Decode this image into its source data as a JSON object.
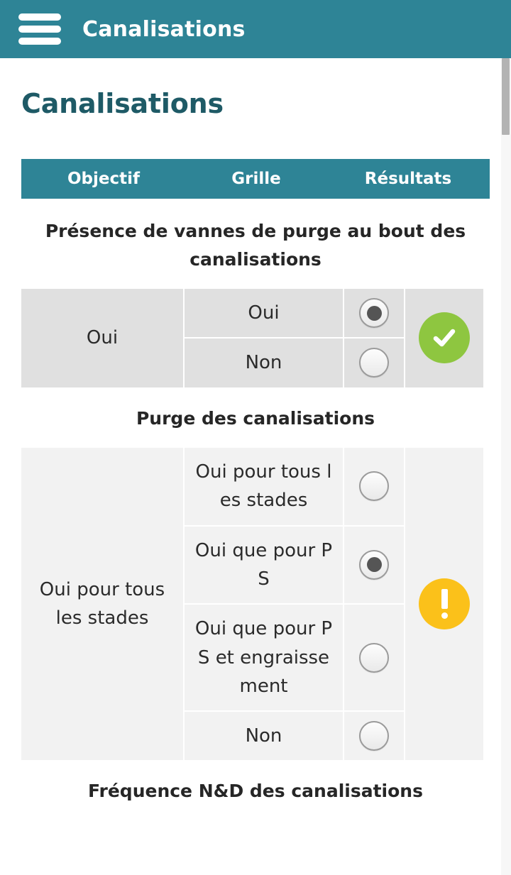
{
  "appbar": {
    "menu_icon": "hamburger-menu-icon",
    "title": "Canalisations"
  },
  "page": {
    "title": "Canalisations"
  },
  "tabs": [
    {
      "label": "Objectif"
    },
    {
      "label": "Grille"
    },
    {
      "label": "Résultats"
    }
  ],
  "questions": [
    {
      "heading": "Présence de vannes de purge au bout des canalisations",
      "answer": "Oui",
      "result_icon": "check-circle-icon",
      "result_status": "ok",
      "options": [
        {
          "label": "Oui",
          "selected": true
        },
        {
          "label": "Non",
          "selected": false
        }
      ]
    },
    {
      "heading": "Purge des canalisations",
      "answer": "Oui pour tous les stades",
      "result_icon": "warning-circle-icon",
      "result_status": "warn",
      "options": [
        {
          "label": "Oui pour tous les stades",
          "selected": false
        },
        {
          "label": "Oui que pour PS",
          "selected": true
        },
        {
          "label": "Oui que pour PS et engraissement",
          "selected": false
        },
        {
          "label": "Non",
          "selected": false
        }
      ]
    },
    {
      "heading": "Fréquence N&D des canalisations"
    }
  ],
  "colors": {
    "appbar": "#2e8496",
    "tabbar": "#2e8496",
    "page_title": "#1e5a66",
    "ok_badge": "#8ec640",
    "warn_badge": "#fbc11a",
    "grid_dark": "#e0e0e0",
    "grid_light": "#f2f2f2"
  },
  "scrollbar": {
    "visible": true
  }
}
